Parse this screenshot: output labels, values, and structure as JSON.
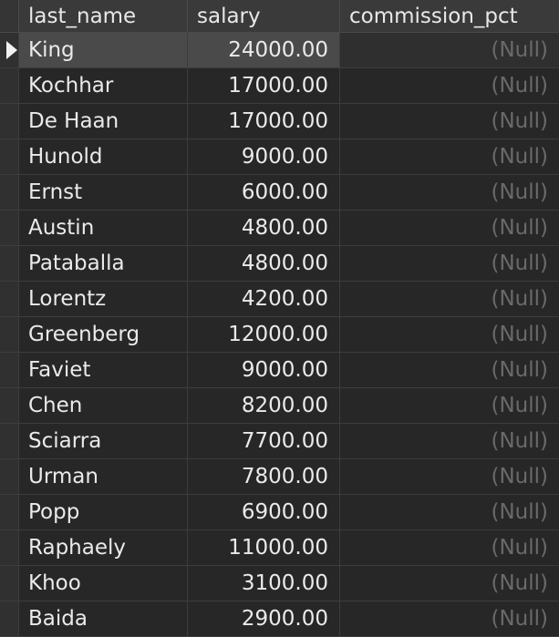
{
  "table": {
    "columns": [
      "last_name",
      "salary",
      "commission_pct"
    ],
    "rows": [
      {
        "last_name": "King",
        "salary": "24000.00",
        "commission_pct": "(Null)"
      },
      {
        "last_name": "Kochhar",
        "salary": "17000.00",
        "commission_pct": "(Null)"
      },
      {
        "last_name": "De Haan",
        "salary": "17000.00",
        "commission_pct": "(Null)"
      },
      {
        "last_name": "Hunold",
        "salary": "9000.00",
        "commission_pct": "(Null)"
      },
      {
        "last_name": "Ernst",
        "salary": "6000.00",
        "commission_pct": "(Null)"
      },
      {
        "last_name": "Austin",
        "salary": "4800.00",
        "commission_pct": "(Null)"
      },
      {
        "last_name": "Pataballa",
        "salary": "4800.00",
        "commission_pct": "(Null)"
      },
      {
        "last_name": "Lorentz",
        "salary": "4200.00",
        "commission_pct": "(Null)"
      },
      {
        "last_name": "Greenberg",
        "salary": "12000.00",
        "commission_pct": "(Null)"
      },
      {
        "last_name": "Faviet",
        "salary": "9000.00",
        "commission_pct": "(Null)"
      },
      {
        "last_name": "Chen",
        "salary": "8200.00",
        "commission_pct": "(Null)"
      },
      {
        "last_name": "Sciarra",
        "salary": "7700.00",
        "commission_pct": "(Null)"
      },
      {
        "last_name": "Urman",
        "salary": "7800.00",
        "commission_pct": "(Null)"
      },
      {
        "last_name": "Popp",
        "salary": "6900.00",
        "commission_pct": "(Null)"
      },
      {
        "last_name": "Raphaely",
        "salary": "11000.00",
        "commission_pct": "(Null)"
      },
      {
        "last_name": "Khoo",
        "salary": "3100.00",
        "commission_pct": "(Null)"
      },
      {
        "last_name": "Baida",
        "salary": "2900.00",
        "commission_pct": "(Null)"
      }
    ],
    "selected_row": 0,
    "icons": {
      "row_pointer": "row-pointer-icon"
    },
    "colors": {
      "background": "#2b2b2b",
      "header": "#3a3a3a",
      "selected": "#4a4a4a",
      "null_text": "#6a6a6a",
      "text": "#eaeaea"
    }
  }
}
